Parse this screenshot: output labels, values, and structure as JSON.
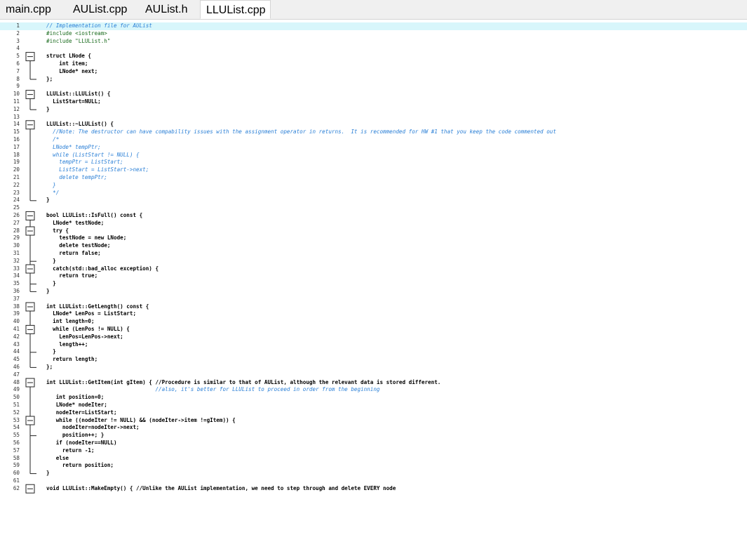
{
  "tabs": [
    {
      "label": "main.cpp",
      "active": false
    },
    {
      "label": "AUList.cpp",
      "active": false
    },
    {
      "label": "AUList.h",
      "active": false
    },
    {
      "label": "LLUList.cpp",
      "active": true
    }
  ],
  "lines": [
    {
      "n": "1",
      "t": "// Implementation file for AUList",
      "k": "cm"
    },
    {
      "n": "2",
      "t": "#include <iostream>",
      "k": "pp"
    },
    {
      "n": "3",
      "t": "#include \"LLUList.h\"",
      "k": "pp"
    },
    {
      "n": "4",
      "t": "",
      "k": ""
    },
    {
      "n": "5",
      "t": "struct LNode {",
      "k": ""
    },
    {
      "n": "6",
      "t": "    int item;",
      "k": ""
    },
    {
      "n": "7",
      "t": "    LNode* next;",
      "k": ""
    },
    {
      "n": "8",
      "t": "};",
      "k": ""
    },
    {
      "n": "9",
      "t": "",
      "k": ""
    },
    {
      "n": "10",
      "t": "LLUList::LLUList() {",
      "k": ""
    },
    {
      "n": "11",
      "t": "  ListStart=NULL;",
      "k": ""
    },
    {
      "n": "12",
      "t": "}",
      "k": ""
    },
    {
      "n": "13",
      "t": "",
      "k": ""
    },
    {
      "n": "14",
      "t": "LLUList::~LLUList() {",
      "k": ""
    },
    {
      "n": "15",
      "t": "  //Note: The destructor can have compability issues with the assignment operator in returns.  It is recommended for HW #1 that you keep the code commented out",
      "k": "cm"
    },
    {
      "n": "16",
      "t": "  /*",
      "k": "cm"
    },
    {
      "n": "17",
      "t": "  LNode* tempPtr;",
      "k": "cm"
    },
    {
      "n": "18",
      "t": "  while (ListStart != NULL) {",
      "k": "cm"
    },
    {
      "n": "19",
      "t": "    tempPtr = ListStart;",
      "k": "cm"
    },
    {
      "n": "20",
      "t": "    ListStart = ListStart->next;",
      "k": "cm"
    },
    {
      "n": "21",
      "t": "    delete tempPtr;",
      "k": "cm"
    },
    {
      "n": "22",
      "t": "  }",
      "k": "cm"
    },
    {
      "n": "23",
      "t": "  */",
      "k": "cm"
    },
    {
      "n": "24",
      "t": "}",
      "k": ""
    },
    {
      "n": "25",
      "t": "",
      "k": ""
    },
    {
      "n": "26",
      "t": "bool LLUList::IsFull() const {",
      "k": ""
    },
    {
      "n": "27",
      "t": "  LNode* testNode;",
      "k": ""
    },
    {
      "n": "28",
      "t": "  try {",
      "k": ""
    },
    {
      "n": "29",
      "t": "    testNode = new LNode;",
      "k": ""
    },
    {
      "n": "30",
      "t": "    delete testNode;",
      "k": ""
    },
    {
      "n": "31",
      "t": "    return false;",
      "k": ""
    },
    {
      "n": "32",
      "t": "  }",
      "k": ""
    },
    {
      "n": "33",
      "t": "  catch(std::bad_alloc exception) {",
      "k": ""
    },
    {
      "n": "34",
      "t": "    return true;",
      "k": ""
    },
    {
      "n": "35",
      "t": "  }",
      "k": ""
    },
    {
      "n": "36",
      "t": "}",
      "k": ""
    },
    {
      "n": "37",
      "t": "",
      "k": ""
    },
    {
      "n": "38",
      "t": "int LLUList::GetLength() const {",
      "k": ""
    },
    {
      "n": "39",
      "t": "  LNode* LenPos = ListStart;",
      "k": ""
    },
    {
      "n": "40",
      "t": "  int length=0;",
      "k": ""
    },
    {
      "n": "41",
      "t": "  while (LenPos != NULL) {",
      "k": ""
    },
    {
      "n": "42",
      "t": "    LenPos=LenPos->next;",
      "k": ""
    },
    {
      "n": "43",
      "t": "    length++;",
      "k": ""
    },
    {
      "n": "44",
      "t": "  }",
      "k": ""
    },
    {
      "n": "45",
      "t": "  return length;",
      "k": ""
    },
    {
      "n": "46",
      "t": "};",
      "k": ""
    },
    {
      "n": "47",
      "t": "",
      "k": ""
    },
    {
      "n": "48",
      "t": "int LLUList::GetItem(int gItem) { //Procedure is similar to that of AUList, although the relevant data is stored different.",
      "k": ""
    },
    {
      "n": "49",
      "t": "                                  //also, it's better for LLUList to proceed in order from the beginning",
      "k": "cm"
    },
    {
      "n": "50",
      "t": "   int position=0;",
      "k": ""
    },
    {
      "n": "51",
      "t": "   LNode* nodeIter;",
      "k": ""
    },
    {
      "n": "52",
      "t": "   nodeIter=ListStart;",
      "k": ""
    },
    {
      "n": "53",
      "t": "   while ((nodeIter != NULL) && (nodeIter->item !=gItem)) {",
      "k": ""
    },
    {
      "n": "54",
      "t": "     nodeIter=nodeIter->next;",
      "k": ""
    },
    {
      "n": "55",
      "t": "     position++; }",
      "k": ""
    },
    {
      "n": "56",
      "t": "   if (nodeIter==NULL)",
      "k": ""
    },
    {
      "n": "57",
      "t": "     return -1;",
      "k": ""
    },
    {
      "n": "58",
      "t": "   else",
      "k": ""
    },
    {
      "n": "59",
      "t": "     return position;",
      "k": ""
    },
    {
      "n": "60",
      "t": "}",
      "k": ""
    },
    {
      "n": "61",
      "t": "",
      "k": ""
    },
    {
      "n": "62",
      "t": "void LLUList::MakeEmpty() { //Unlike the AUList implementation, we need to step through and delete EVERY node",
      "k": ""
    }
  ]
}
